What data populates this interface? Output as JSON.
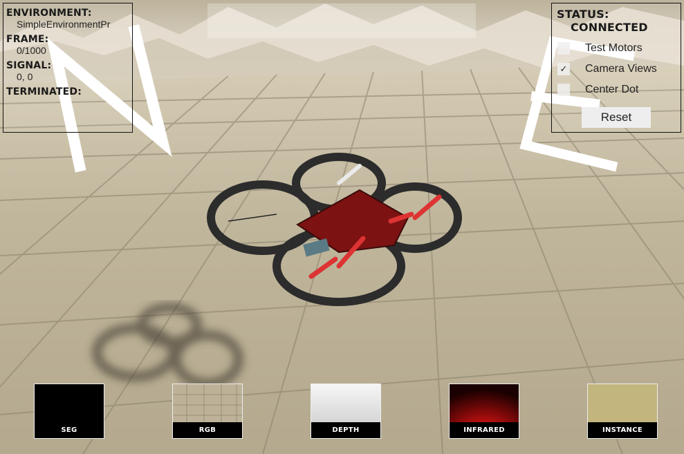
{
  "info": {
    "environment_label": "Environment:",
    "environment_value": "SimpleEnvironmentPr",
    "frame_label": "Frame:",
    "frame_value": "0/1000",
    "signal_label": "Signal:",
    "signal_value": "0, 0",
    "terminated_label": "Terminated:"
  },
  "status": {
    "status_label": "Status:",
    "status_value": "Connected",
    "toggles": [
      {
        "label": "Test Motors",
        "checked": false
      },
      {
        "label": "Camera Views",
        "checked": true
      },
      {
        "label": "Center Dot",
        "checked": false
      }
    ],
    "checkmark": "✓",
    "reset_label": "Reset"
  },
  "cameras": [
    {
      "label": "SEG"
    },
    {
      "label": "RGB"
    },
    {
      "label": "Depth"
    },
    {
      "label": "Infrared"
    },
    {
      "label": "Instance"
    }
  ],
  "compass": {
    "north": "N",
    "east": "E"
  },
  "colors": {
    "floor": "#b8ae96",
    "sky": "#d8cfbc",
    "drone_body": "#8a1414",
    "drone_frame": "#2a2a2a",
    "instance_view": "#c2b67e",
    "infrared_view": "#c41010"
  }
}
